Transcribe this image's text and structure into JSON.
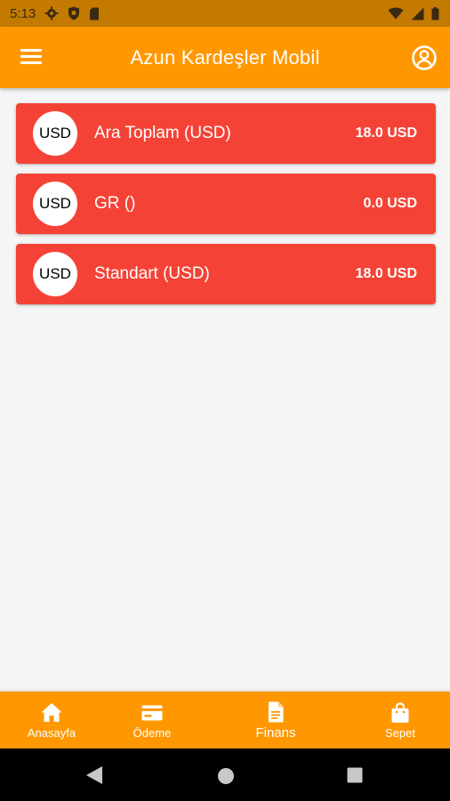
{
  "status_bar": {
    "time": "5:13"
  },
  "app_bar": {
    "title": "Azun Kardeşler Mobil"
  },
  "accounts": [
    {
      "avatar": "USD",
      "label": "Ara Toplam (USD)",
      "value": "18.0 USD"
    },
    {
      "avatar": "USD",
      "label": "GR ()",
      "value": "0.0 USD"
    },
    {
      "avatar": "USD",
      "label": "Standart (USD)",
      "value": "18.0 USD"
    }
  ],
  "bottom_nav": {
    "items": [
      {
        "label": "Anasayfa",
        "icon": "home-icon"
      },
      {
        "label": "Ödeme",
        "icon": "credit-card-icon"
      },
      {
        "label": "Finans",
        "icon": "document-icon",
        "active": true
      },
      {
        "label": "Sepet",
        "icon": "shopping-bag-icon"
      }
    ]
  },
  "colors": {
    "primary": "#ff9800",
    "status_bar": "#c47a00",
    "card": "#f44336",
    "background": "#f5f5f5"
  }
}
